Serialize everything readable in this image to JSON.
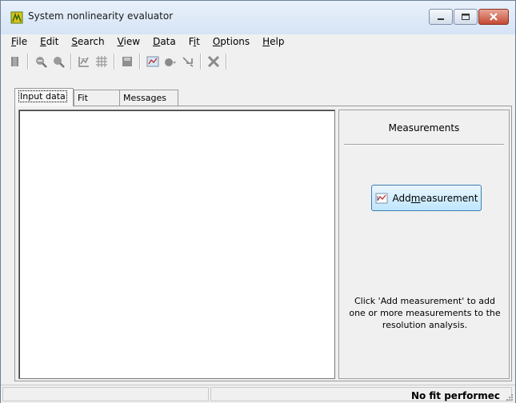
{
  "window": {
    "title": "System nonlinearity evaluator"
  },
  "menu": {
    "items": [
      {
        "accel": "F",
        "rest": "ile"
      },
      {
        "accel": "E",
        "rest": "dit"
      },
      {
        "accel": "S",
        "rest": "earch"
      },
      {
        "accel": "V",
        "rest": "iew"
      },
      {
        "accel": "D",
        "rest": "ata"
      },
      {
        "pre": "F",
        "accel": "i",
        "rest": "t"
      },
      {
        "accel": "O",
        "rest": "ptions"
      },
      {
        "accel": "H",
        "rest": "elp"
      }
    ]
  },
  "toolbar": {
    "icons": [
      "open-icon",
      "zoom-out-icon",
      "zoom-in-icon",
      "chart-icon",
      "grid-icon",
      "save-icon",
      "add-measurement-icon",
      "fit-icon",
      "arrow-icon",
      "delete-icon"
    ]
  },
  "tabs": [
    {
      "label": "Input data",
      "active": true
    },
    {
      "label": "Fit",
      "active": false
    },
    {
      "label": "Messages",
      "active": false
    }
  ],
  "measurements": {
    "title": "Measurements",
    "add_button": {
      "pre": "Add ",
      "accel": "m",
      "rest": "easurement"
    },
    "hint_line1": "Click 'Add measurement' to add",
    "hint_line2": "one or more measurements to the",
    "hint_line3": "resolution analysis."
  },
  "status": {
    "text": "No fit performec"
  },
  "colors": {
    "accent": "#3c7fb1",
    "close": "#c44b34"
  }
}
